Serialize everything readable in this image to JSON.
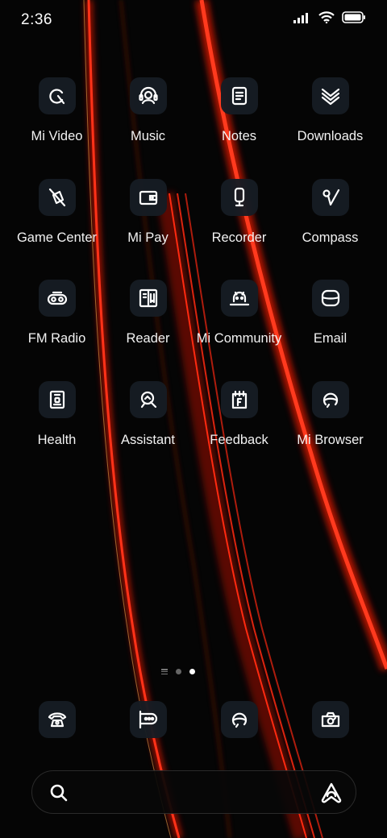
{
  "status_bar": {
    "time": "2:36",
    "icons": [
      "signal-icon",
      "wifi-icon",
      "battery-icon"
    ]
  },
  "home": {
    "apps": [
      {
        "label": "Mi Video",
        "icon": "play-icon"
      },
      {
        "label": "Music",
        "icon": "headset-icon"
      },
      {
        "label": "Notes",
        "icon": "notebook-icon"
      },
      {
        "label": "Downloads",
        "icon": "download-chevrons-icon"
      },
      {
        "label": "Game Center",
        "icon": "game-icon"
      },
      {
        "label": "Mi Pay",
        "icon": "wallet-icon"
      },
      {
        "label": "Recorder",
        "icon": "microphone-icon"
      },
      {
        "label": "Compass",
        "icon": "compass-icon"
      },
      {
        "label": "FM Radio",
        "icon": "radio-icon"
      },
      {
        "label": "Reader",
        "icon": "book-icon"
      },
      {
        "label": "Mi Community",
        "icon": "robot-icon"
      },
      {
        "label": "Email",
        "icon": "mail-icon"
      },
      {
        "label": "Health",
        "icon": "health-icon"
      },
      {
        "label": "Assistant",
        "icon": "assistant-icon"
      },
      {
        "label": "Feedback",
        "icon": "feedback-icon"
      },
      {
        "label": "Mi Browser",
        "icon": "browser-icon"
      }
    ],
    "page_indicator": {
      "pages": 2,
      "active": 2
    }
  },
  "dock": {
    "apps": [
      {
        "icon": "phone-icon"
      },
      {
        "icon": "messages-icon"
      },
      {
        "icon": "browser-icon"
      },
      {
        "icon": "camera-icon"
      }
    ]
  },
  "search_bar": {
    "left_icon": "search-icon",
    "right_icon": "assistant-icon"
  },
  "colors": {
    "background": "#050505",
    "streak": "#ff2a10",
    "icon_tile": "#161c23",
    "text": "#ffffff"
  }
}
